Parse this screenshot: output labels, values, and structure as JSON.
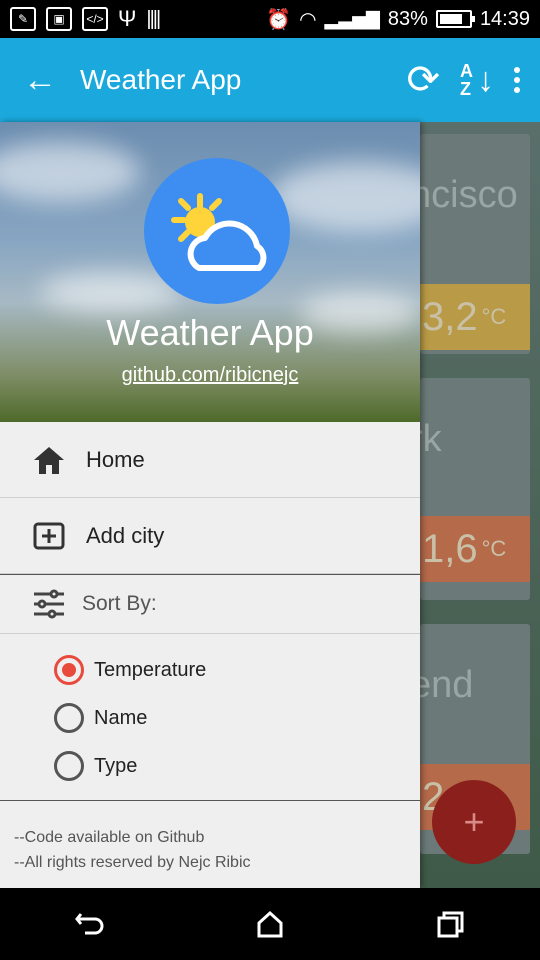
{
  "status": {
    "battery": "83%",
    "time": "14:39"
  },
  "app_bar": {
    "title": "Weather App"
  },
  "background": {
    "cards": [
      {
        "city_fragment": "ncisco",
        "temp": "3,2",
        "unit": "°C",
        "temp_color": "#b99a46"
      },
      {
        "city_fragment": "rk",
        "temp": "1,6",
        "unit": "°C",
        "temp_color": "#b56a4a"
      },
      {
        "city_fragment": "end",
        "temp": "2",
        "unit": "°C",
        "temp_color": "#b56a4a"
      }
    ],
    "fab_label": "+"
  },
  "drawer": {
    "header": {
      "app_name": "Weather App",
      "link": "github.com/ribicnejc"
    },
    "items": [
      {
        "label": "Home",
        "icon": "home-icon"
      },
      {
        "label": "Add city",
        "icon": "add-box-icon"
      }
    ],
    "sort": {
      "label": "Sort By:",
      "options": [
        {
          "label": "Temperature",
          "selected": true
        },
        {
          "label": "Name",
          "selected": false
        },
        {
          "label": "Type",
          "selected": false
        }
      ]
    },
    "footer": {
      "line1": "--Code available on Github",
      "line2": "--All rights reserved by Nejc Ribic"
    }
  },
  "colors": {
    "accent": "#1ba9dd",
    "radio_selected": "#e84a3c"
  }
}
